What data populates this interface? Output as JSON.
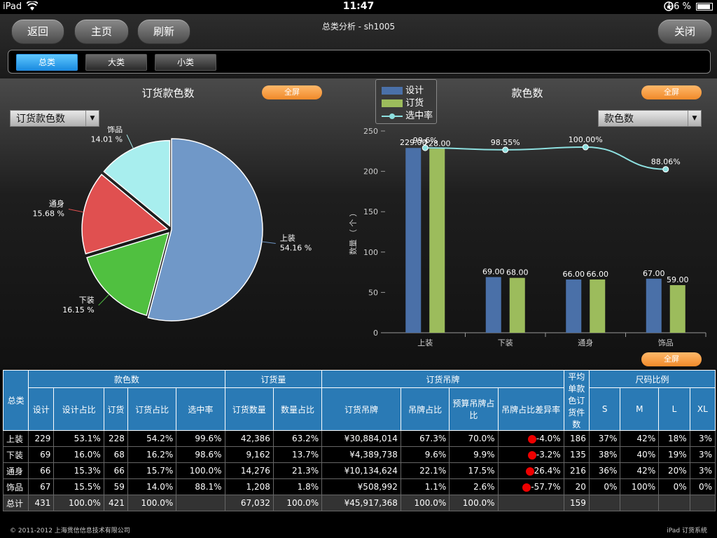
{
  "status": {
    "carrier": "iPad",
    "time": "11:47",
    "battery": "96 %"
  },
  "header": {
    "title": "总类分析 - sh1005",
    "back_label": "返回",
    "home_label": "主页",
    "refresh_label": "刷新",
    "close_label": "关闭",
    "tabs": [
      {
        "label": "总类"
      },
      {
        "label": "大类"
      },
      {
        "label": "小类"
      }
    ]
  },
  "left_panel": {
    "title": "订货款色数",
    "fullscreen_label": "全屏",
    "select_value": "订货款色数"
  },
  "right_panel": {
    "title": "款色数",
    "fullscreen_label": "全屏",
    "select_value": "款色数"
  },
  "table_fullscreen_label": "全屏",
  "chart_data": [
    {
      "type": "pie",
      "title": "订货款色数",
      "slices": [
        {
          "label": "上装",
          "value": 54.16,
          "pct_label": "54.16 %",
          "color": "#7098c8"
        },
        {
          "label": "下装",
          "value": 16.15,
          "pct_label": "16.15 %",
          "color": "#50c040"
        },
        {
          "label": "通身",
          "value": 15.68,
          "pct_label": "15.68 %",
          "color": "#e05050"
        },
        {
          "label": "饰品",
          "value": 14.01,
          "pct_label": "14.01 %",
          "color": "#a8eeee"
        }
      ]
    },
    {
      "type": "bar",
      "title": "款色数",
      "categories": [
        "上装",
        "下装",
        "通身",
        "饰品"
      ],
      "ylabel": "数量 （ 个 ）",
      "ylim": [
        0,
        250
      ],
      "yticks": [
        "0",
        "50",
        "100",
        "150",
        "200",
        "250"
      ],
      "series": [
        {
          "name": "设计",
          "values": [
            229,
            69,
            66,
            67
          ],
          "labels": [
            "229.00",
            "69.00",
            "66.00",
            "67.00"
          ],
          "color": "#4a70a8"
        },
        {
          "name": "订货",
          "values": [
            228,
            68,
            66,
            59
          ],
          "labels": [
            "228.00",
            "68.00",
            "66.00",
            "59.00"
          ],
          "color": "#9cbc5c"
        }
      ],
      "line": {
        "name": "选中率",
        "values": [
          99.6,
          98.55,
          100.0,
          88.06
        ],
        "labels": [
          "99.6%",
          "98.55%",
          "100.00%",
          "88.06%"
        ],
        "color": "#8ee0e0"
      }
    }
  ],
  "table": {
    "group_headers": [
      "总类",
      "款色数",
      "订货量",
      "订货吊牌",
      "平均单款色订货件数",
      "尺码比例"
    ],
    "sub_headers": [
      "设计",
      "设计占比",
      "订货",
      "订货占比",
      "选中率",
      "订货数量",
      "数量占比",
      "订货吊牌",
      "吊牌占比",
      "预算吊牌占比",
      "吊牌占比差异率",
      "S",
      "M",
      "L",
      "XL"
    ],
    "rows": [
      [
        "上装",
        "229",
        "53.1%",
        "228",
        "54.2%",
        "99.6%",
        "42,386",
        "63.2%",
        "¥30,884,014",
        "67.3%",
        "70.0%",
        "-4.0%",
        "186",
        "37%",
        "42%",
        "18%",
        "3%"
      ],
      [
        "下装",
        "69",
        "16.0%",
        "68",
        "16.2%",
        "98.6%",
        "9,162",
        "13.7%",
        "¥4,389,738",
        "9.6%",
        "9.9%",
        "-3.2%",
        "135",
        "38%",
        "40%",
        "19%",
        "3%"
      ],
      [
        "通身",
        "66",
        "15.3%",
        "66",
        "15.7%",
        "100.0%",
        "14,276",
        "21.3%",
        "¥10,134,624",
        "22.1%",
        "17.5%",
        "26.4%",
        "216",
        "36%",
        "42%",
        "20%",
        "3%"
      ],
      [
        "饰品",
        "67",
        "15.5%",
        "59",
        "14.0%",
        "88.1%",
        "1,208",
        "1.8%",
        "¥508,992",
        "1.1%",
        "2.6%",
        "-57.7%",
        "20",
        "0%",
        "100%",
        "0%",
        "0%"
      ]
    ],
    "total": [
      "总计",
      "431",
      "100.0%",
      "421",
      "100.0%",
      "",
      "67,032",
      "100.0%",
      "¥45,917,368",
      "100.0%",
      "100.0%",
      "",
      "159",
      "",
      "",
      "",
      ""
    ]
  },
  "footer": {
    "copyright": "© 2011-2012 上海贯信信息技术有限公司",
    "app_name": "iPad 订货系统"
  }
}
